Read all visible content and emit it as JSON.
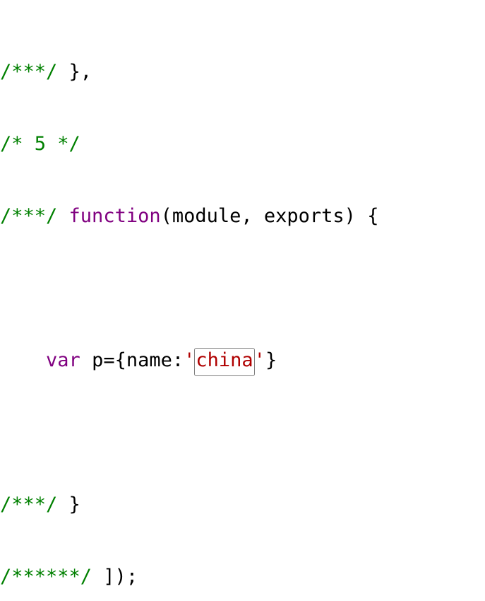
{
  "code": {
    "line1": {
      "comment": "/***/",
      "plain": " },"
    },
    "line2": {
      "comment": "/* 5 */"
    },
    "line3": {
      "comment": "/***/",
      "keyword": "function",
      "plain": "(module, exports) {"
    },
    "line5": {
      "indent": "    ",
      "keyword": "var",
      "plain_before": " p={name:",
      "quote_open": "'",
      "highlighted": "china",
      "quote_close": "'",
      "plain_after": "}"
    },
    "line7": {
      "comment": "/***/",
      "plain": " }"
    },
    "line8": {
      "comment": "/******/",
      "plain": " ]);"
    }
  },
  "colors": {
    "comment": "#008000",
    "keyword": "#800080",
    "string": "#b00000",
    "highlight_border": "#808080"
  }
}
